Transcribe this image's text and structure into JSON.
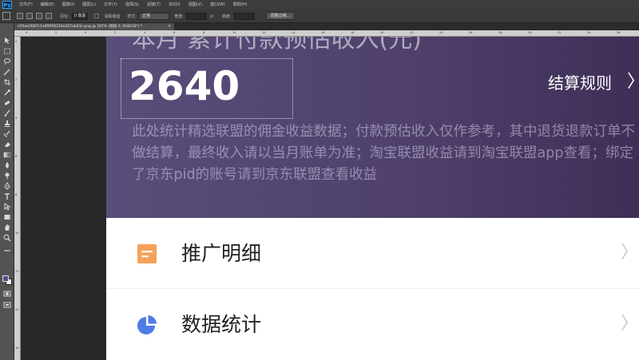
{
  "app": {
    "menu": [
      "文件(F)",
      "编辑(E)",
      "图像(I)",
      "图层(L)",
      "文字(Y)",
      "选择(S)",
      "滤镜(T)",
      "3D(D)",
      "视图(V)",
      "窗口(W)",
      "帮助(H)"
    ]
  },
  "options": {
    "feather_label": "羽化:",
    "feather_value": "0 像素",
    "antialias_label": "消除锯齿",
    "style_label": "样式:",
    "style_value": "正常",
    "width_label": "宽度:",
    "height_label": "高度:",
    "refine_button": "调整边缘..."
  },
  "document": {
    "tab_title": "e55ae2687c1e8f9f56216e207ab43c.png @ 187% (图层 0, RGB/16*) *",
    "close_glyph": "×"
  },
  "ruler": {
    "h_numbers": [
      "4",
      "2",
      "0",
      "2",
      "4",
      "6",
      "8",
      "10",
      "12",
      "14",
      "16",
      "18",
      "20",
      "22",
      "24",
      "26",
      "28",
      "30",
      "32",
      "34",
      "36"
    ],
    "v_numbers": [
      "0",
      "2",
      "4",
      "6",
      "8",
      "10",
      "12",
      "14",
      "16"
    ]
  },
  "canvas": {
    "header_title": "本月 累计付款预估收入(元)",
    "amount": "2640",
    "rules_link": "结算规则",
    "rules_chevron": "〉",
    "notice": "此处统计精选联盟的佣金收益数据；付款预估收入仅作参考，其中退货退款订单不做结算，最终收入请以当月账单为准；淘宝联盟收益请到淘宝联盟app查看；绑定了京东pid的账号请到京东联盟查看收益",
    "rows": [
      {
        "label": "推广明细",
        "chevron": "〉",
        "icon": "document-list-icon",
        "icon_color": "#f5a15a"
      },
      {
        "label": "数据统计",
        "chevron": "〉",
        "icon": "pie-chart-icon",
        "icon_color": "#4f7be8"
      }
    ]
  },
  "colors": {
    "header_start": "#5a4d7a",
    "header_end": "#3f2f57",
    "ps_chrome": "#535353"
  }
}
